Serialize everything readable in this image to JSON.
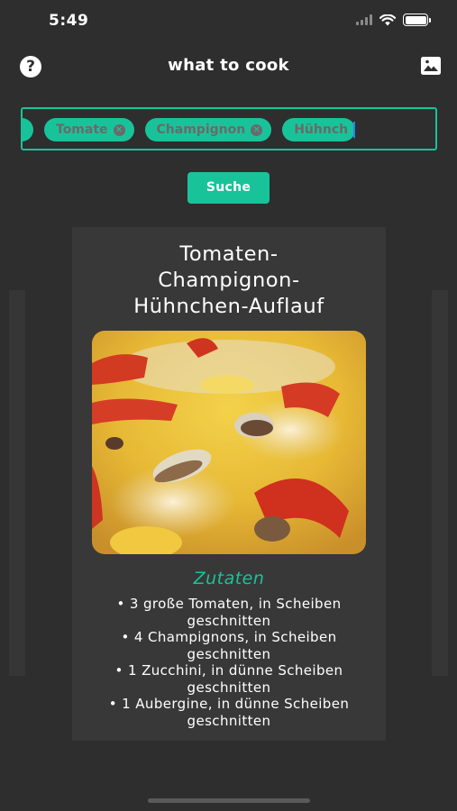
{
  "status_bar": {
    "time": "5:49"
  },
  "nav": {
    "title": "what to cook",
    "left_icon": "help-circle-icon",
    "right_icon": "image-icon"
  },
  "tag_input": {
    "tags": [
      "Tomate",
      "Champignon"
    ],
    "typing_text": "Hühnch"
  },
  "search_button": {
    "label": "Suche"
  },
  "recipe": {
    "title_lines": [
      "Tomaten-",
      "Champignon-",
      "Hühnchen-Auflauf"
    ],
    "ingredients_heading": "Zutaten",
    "ingredients": [
      {
        "line1": "• 3 große Tomaten, in Scheiben",
        "line2": "geschnitten"
      },
      {
        "line1": "• 4 Champignons, in Scheiben",
        "line2": "geschnitten"
      },
      {
        "line1": "• 1 Zucchini, in dünne Scheiben",
        "line2": "geschnitten"
      },
      {
        "line1": "• 1 Aubergine, in dünne Scheiben",
        "line2": "geschnitten"
      }
    ]
  },
  "colors": {
    "background": "#2e2e2e",
    "card": "#383838",
    "accent": "#19c39a",
    "text": "#ffffff"
  }
}
